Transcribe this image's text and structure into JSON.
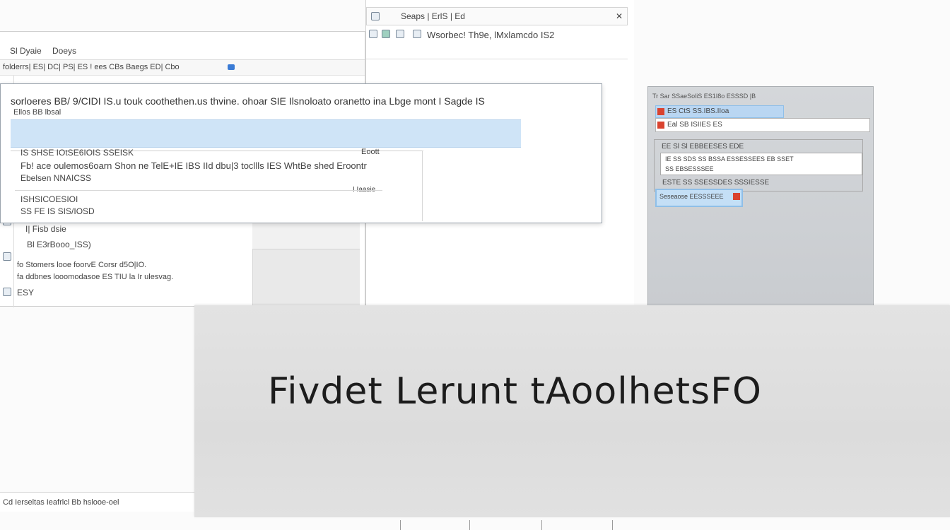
{
  "left_window": {
    "menu": [
      "Sl Dyaie",
      "Doeys"
    ],
    "toolbar_text": "folderrs| ES| DC| PS| ES ! ees CBs Baegs  ED| Cbo",
    "tree_items": [
      "I| Fisb dsie",
      "Bl E3rBooo_ISS)",
      "fo Stomers looe foorvE Corsr d5O|IO.",
      "fa ddbnes looomodasoe ES TIU la Ir ulesvag.",
      "ESY"
    ],
    "status": "Cd Ierseltas Ieafrlcl Bb hslooe-oel"
  },
  "center_window": {
    "title": "Seaps  |  ErlS  |  Ed",
    "address": "Wsorbec! Th9e, lMxlamcdo IS2"
  },
  "dialog": {
    "title": "sorloeres BB/ 9/CIDI IS.u touk coothethen.us thvine. ohoar SIE Ilsnoloato oranetto ina Lbge mont  I  Sagde IS",
    "subtitle": "Ellos BB lbsal",
    "rows": [
      {
        "text": "IS SHSE IOtSE6IOIS SSEISK",
        "right": "Eoott"
      },
      {
        "text": "Fb! ace oulemos6oarn Shon ne TelE+IE  IBS IId dbu|3 tocllls IES WhtBe shed Eroontr",
        "right": ""
      },
      {
        "text": "Ebelsen NNAICSS",
        "right": ""
      },
      {
        "text": "",
        "right": "I Iaasie"
      },
      {
        "text": "ISHSICOESIOI",
        "right": ""
      },
      {
        "text": "SS FE IS SIS/IOSD",
        "right": ""
      }
    ]
  },
  "right_panel": {
    "header": "Tr Sar SSaeSoliS   ES1I8o   ESSSD  |B",
    "row1": "ES CtS SS.IBS.IIoa",
    "row2": "Eal SB ISIIES ES",
    "group_title": "EE Sl Sl EBBEESES EDE",
    "group_row1": "IE SS SDS SS BSSA ESSESSEES EB SSET",
    "group_row2": "SS EBSESSSEE",
    "footer": "ESTE SS SSESSDES SSSIESSE",
    "button": "Seseaose EESSSEEE"
  },
  "banner": {
    "headline": "Fivdet Lerunt tAoolhetsFO"
  },
  "colors": {
    "selection": "#cfe4f7",
    "accent_red": "#d9432f",
    "panel_blue": "#8fbfe8"
  }
}
